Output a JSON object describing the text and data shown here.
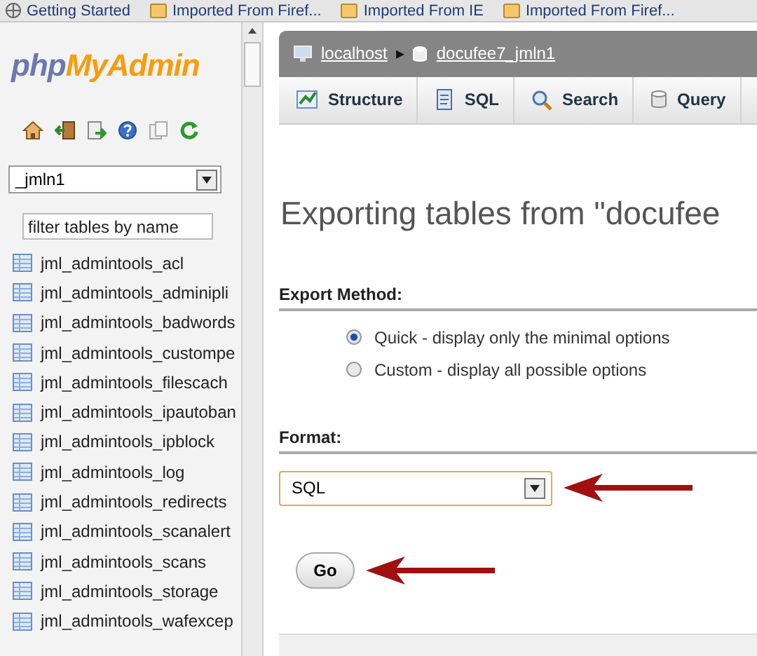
{
  "bookmarks": [
    {
      "label": "Getting Started",
      "kind": "globe"
    },
    {
      "label": "Imported From Firef...",
      "kind": "folder"
    },
    {
      "label": "Imported From IE",
      "kind": "folder"
    },
    {
      "label": "Imported From Firef...",
      "kind": "folder"
    }
  ],
  "sidebar": {
    "logo": {
      "part_1": "php",
      "part_2": "MyAdmin"
    },
    "database_select": {
      "value": "_jmln1"
    },
    "filter": {
      "placeholder": "filter tables by name"
    },
    "tables": [
      "jml_admintools_acl",
      "jml_admintools_adminipli",
      "jml_admintools_badwords",
      "jml_admintools_custompe",
      "jml_admintools_filescach",
      "jml_admintools_ipautoban",
      "jml_admintools_ipblock",
      "jml_admintools_log",
      "jml_admintools_redirects",
      "jml_admintools_scanalert",
      "jml_admintools_scans",
      "jml_admintools_storage",
      "jml_admintools_wafexcep"
    ]
  },
  "breadcrumb": {
    "server": "localhost",
    "separator": "▸",
    "database": "docufee7_jmln1"
  },
  "tabs": [
    {
      "label": "Structure",
      "kind": "structure"
    },
    {
      "label": "SQL",
      "kind": "sql"
    },
    {
      "label": "Search",
      "kind": "search"
    },
    {
      "label": "Query",
      "kind": "query"
    }
  ],
  "title": "Exporting tables from \"docufee",
  "export_method": {
    "heading": "Export Method:",
    "options": [
      {
        "label": "Quick - display only the minimal options",
        "selected": true
      },
      {
        "label": "Custom - display all possible options",
        "selected": false
      }
    ]
  },
  "format": {
    "heading": "Format:",
    "value": "SQL"
  },
  "go_button": "Go"
}
